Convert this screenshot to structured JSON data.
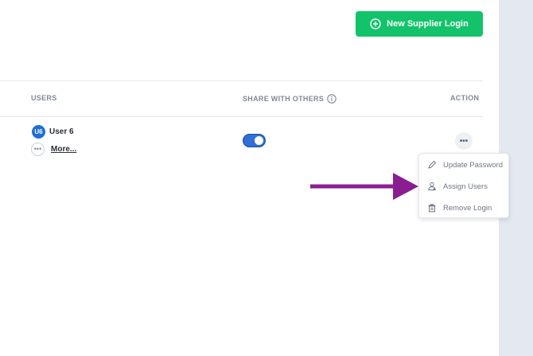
{
  "header": {
    "new_button_label": "New Supplier Login"
  },
  "table": {
    "columns": {
      "users": "USERS",
      "share": "SHARE WITH OTHERS",
      "action": "ACTION"
    },
    "row": {
      "avatar_initials": "U6",
      "user_name": "User 6",
      "more_label": "More...",
      "more_icon_text": "•••",
      "action_icon_text": "•••",
      "share_enabled": true
    }
  },
  "menu": {
    "items": [
      {
        "label": "Update Password",
        "icon": "pencil-icon"
      },
      {
        "label": "Assign Users",
        "icon": "assign-users-icon"
      },
      {
        "label": "Remove Login",
        "icon": "trash-icon"
      }
    ]
  },
  "colors": {
    "primary_green": "#12c36a",
    "toggle_blue": "#2f6fd6",
    "avatar_blue": "#1f6fd6",
    "arrow_purple": "#8a1e91",
    "side_panel": "#e4e8ef"
  }
}
